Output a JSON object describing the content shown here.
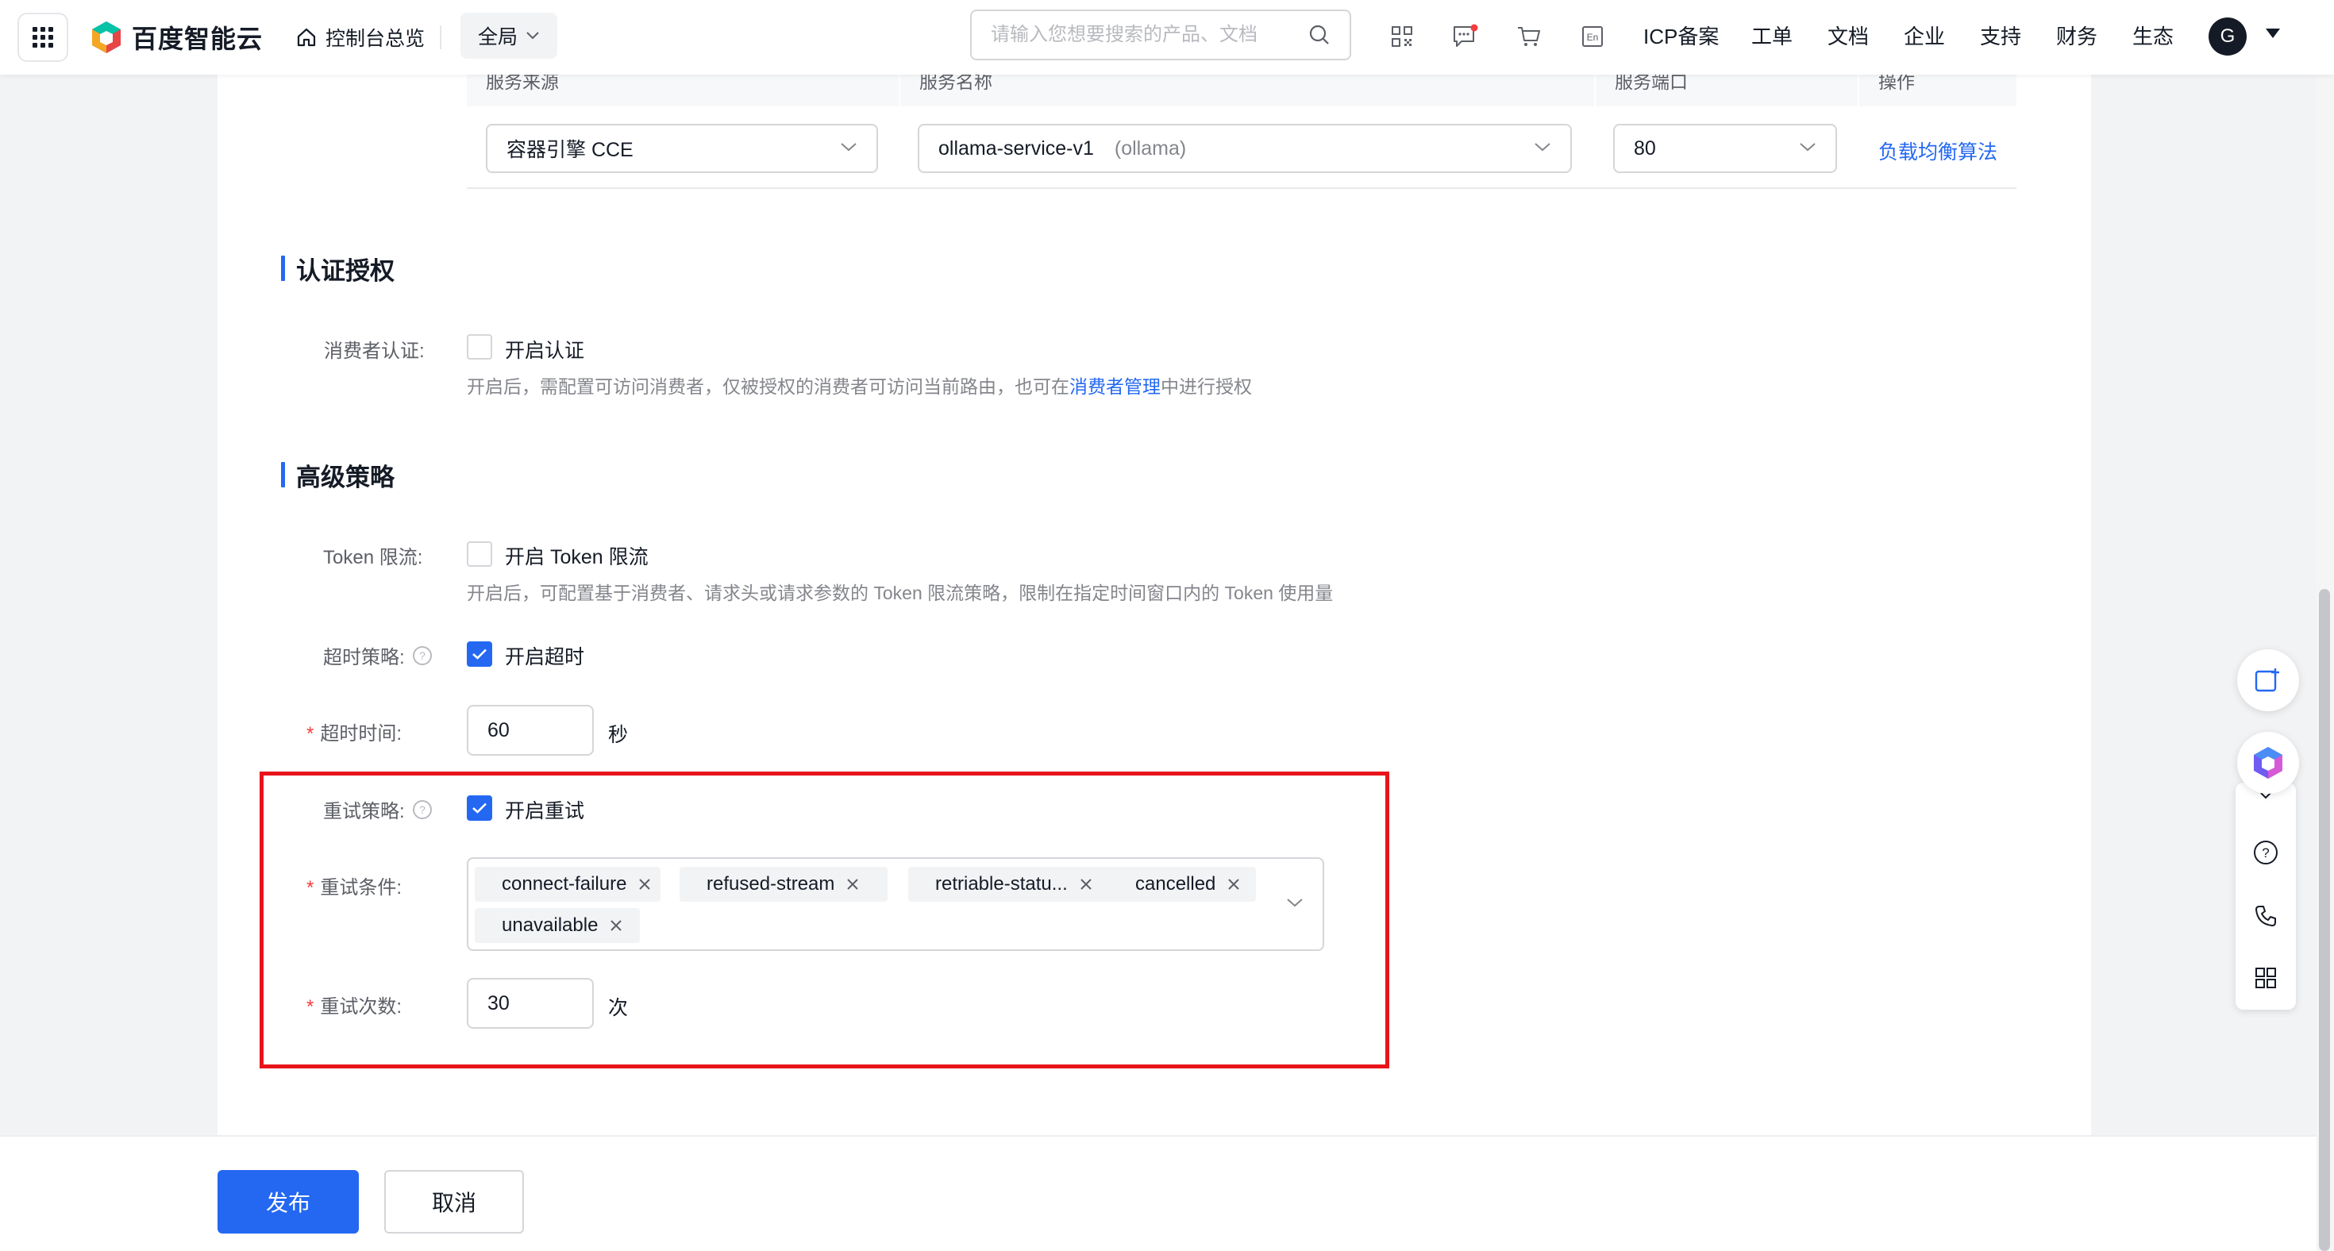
{
  "topbar": {
    "logo_text": "百度智能云",
    "home_label": "控制台总览",
    "region_label": "全局",
    "search_placeholder": "请输入您想要搜索的产品、文档",
    "links": [
      "ICP备案",
      "工单",
      "文档",
      "企业",
      "支持",
      "财务",
      "生态"
    ],
    "lang_icon_text": "En",
    "avatar_letter": "G"
  },
  "service_table": {
    "columns": [
      "服务来源",
      "服务名称",
      "服务端口",
      "操作"
    ],
    "row": {
      "source": "容器引擎 CCE",
      "service_name": "ollama-service-v1",
      "service_namespace": "(ollama)",
      "port": "80",
      "action": "负载均衡算法"
    }
  },
  "auth_section": {
    "title": "认证授权",
    "consumer_auth_label": "消费者认证:",
    "enable_auth_text": "开启认证",
    "enable_auth_checked": false,
    "desc_prefix": "开启后，需配置可访问消费者，仅被授权的消费者可访问当前路由，也可在",
    "desc_link": "消费者管理",
    "desc_suffix": "中进行授权"
  },
  "advanced_section": {
    "title": "高级策略",
    "token_limit_label": "Token 限流:",
    "token_limit_text": "开启 Token 限流",
    "token_limit_checked": false,
    "token_limit_desc": "开启后，可配置基于消费者、请求头或请求参数的 Token 限流策略，限制在指定时间窗口内的 Token 使用量",
    "timeout_policy_label": "超时策略:",
    "timeout_enable_text": "开启超时",
    "timeout_checked": true,
    "timeout_time_label": "超时时间:",
    "timeout_value": "60",
    "timeout_unit": "秒",
    "retry_policy_label": "重试策略:",
    "retry_enable_text": "开启重试",
    "retry_checked": true,
    "retry_condition_label": "重试条件:",
    "retry_conditions": [
      "connect-failure",
      "refused-stream",
      "retriable-statu...",
      "cancelled",
      "unavailable"
    ],
    "retry_count_label": "重试次数:",
    "retry_count_value": "30",
    "retry_count_unit": "次"
  },
  "footer": {
    "publish_label": "发布",
    "cancel_label": "取消"
  },
  "colors": {
    "accent": "#2468f2",
    "highlight_border": "#e8141b",
    "required": "#f33e3e"
  },
  "icons": [
    "grid-icon",
    "home-icon",
    "search-icon",
    "qr-code-icon",
    "message-icon",
    "cart-icon",
    "language-icon",
    "help-circle-icon",
    "phone-icon",
    "apps-icon",
    "chevron-down-icon",
    "close-icon",
    "check-icon"
  ]
}
